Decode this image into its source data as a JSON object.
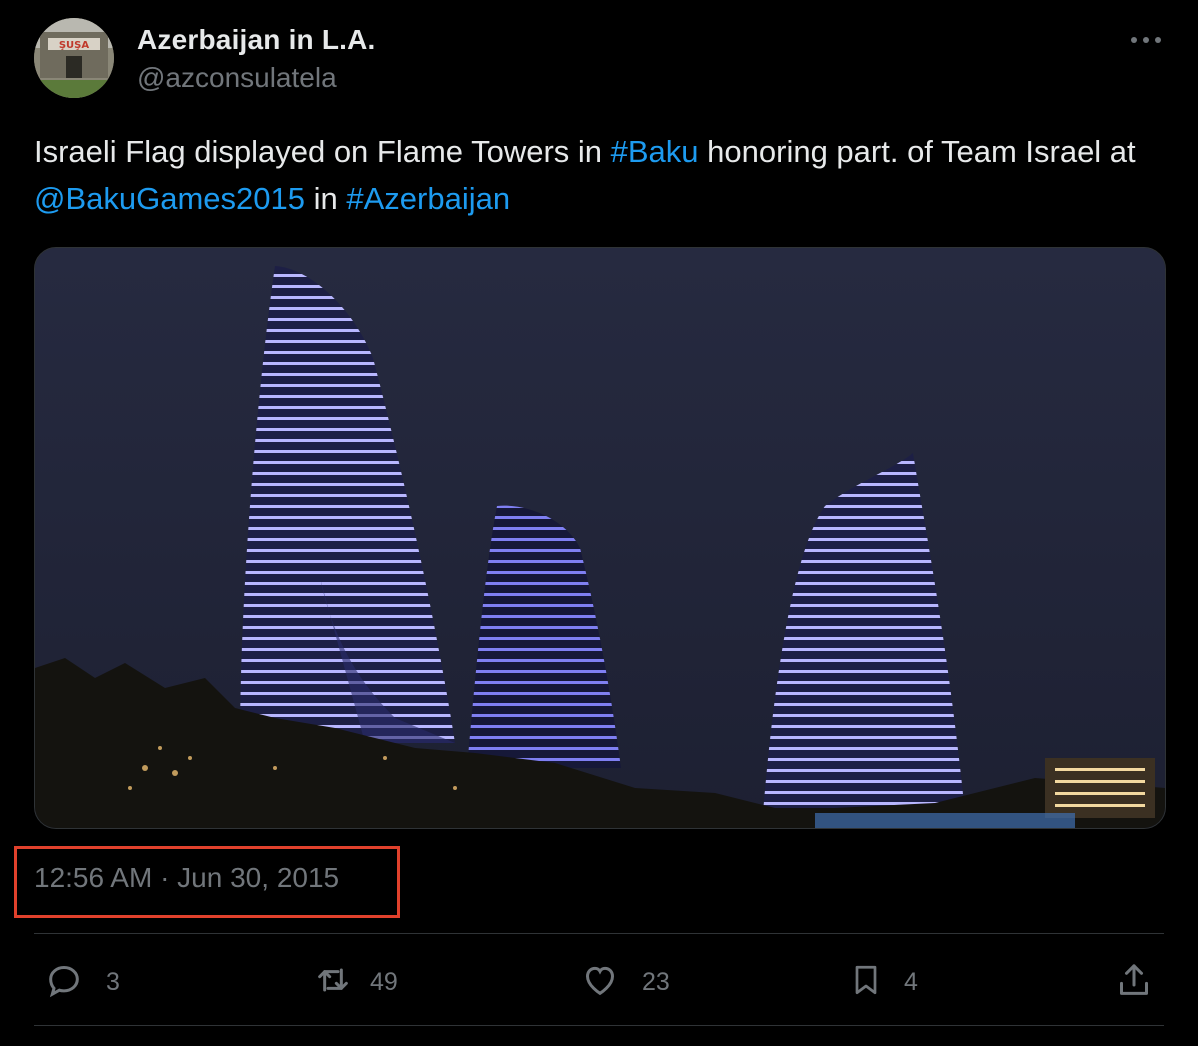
{
  "author": {
    "display_name": "Azerbaijan in L.A.",
    "handle": "@azconsulatela",
    "avatar_sign_text": "ŞUŞA"
  },
  "tweet": {
    "text_parts": [
      {
        "text": "Israeli Flag displayed on Flame Towers in ",
        "type": "text"
      },
      {
        "text": "#Baku",
        "type": "link"
      },
      {
        "text": " honoring part. of Team Israel at ",
        "type": "text"
      },
      {
        "text": "@BakuGames2015",
        "type": "link"
      },
      {
        "text": " in ",
        "type": "text"
      },
      {
        "text": "#Azerbaijan",
        "type": "link"
      }
    ],
    "timestamp": "12:56 AM · Jun 30, 2015"
  },
  "actions": {
    "replies": "3",
    "reposts": "49",
    "likes": "23",
    "bookmarks": "4"
  },
  "icons": [
    "more-icon",
    "reply-icon",
    "repost-icon",
    "like-icon",
    "bookmark-icon",
    "share-icon"
  ],
  "colors": {
    "background": "#000000",
    "text": "#e7e9ea",
    "muted": "#71767b",
    "link": "#1d9bf0",
    "highlight_box": "#e0412c",
    "divider": "#2f3336"
  }
}
